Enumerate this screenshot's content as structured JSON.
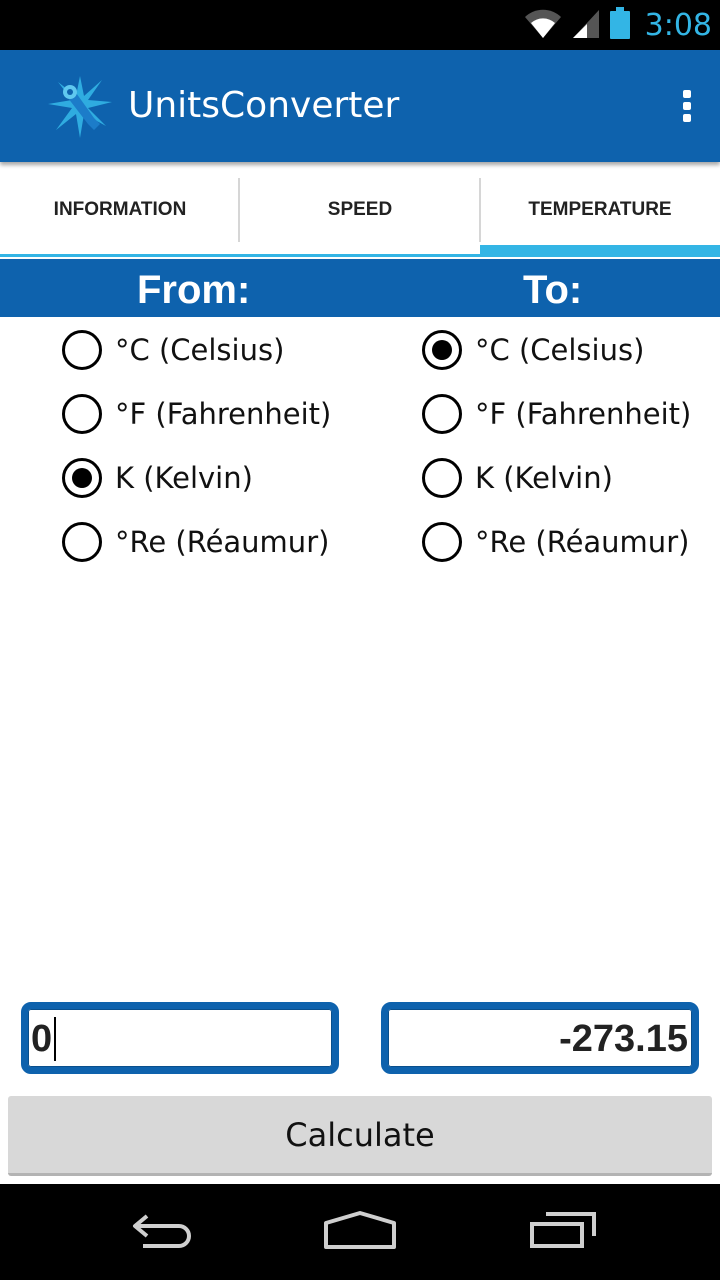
{
  "status_bar": {
    "time": "3:08",
    "icons": [
      "wifi-icon",
      "signal-icon",
      "battery-icon"
    ],
    "accent_color": "#33b5e5"
  },
  "action_bar": {
    "title": "UnitsConverter",
    "icon": "app-logo-icon",
    "overflow_icon": "overflow-menu-icon",
    "color": "#0e62ad"
  },
  "tabs": [
    {
      "label": "INFORMATION",
      "active": false
    },
    {
      "label": "SPEED",
      "active": false
    },
    {
      "label": "TEMPERATURE",
      "active": true
    }
  ],
  "converter": {
    "from_label": "From:",
    "to_label": "To:",
    "from_options": [
      {
        "label": "°C (Celsius)",
        "checked": false
      },
      {
        "label": "°F (Fahrenheit)",
        "checked": false
      },
      {
        "label": "K (Kelvin)",
        "checked": true
      },
      {
        "label": "°Re (Réaumur)",
        "checked": false
      }
    ],
    "to_options": [
      {
        "label": "°C (Celsius)",
        "checked": true
      },
      {
        "label": "°F (Fahrenheit)",
        "checked": false
      },
      {
        "label": "K (Kelvin)",
        "checked": false
      },
      {
        "label": "°Re (Réaumur)",
        "checked": false
      }
    ],
    "input_value": "0",
    "result_value": "-273.15",
    "calculate_label": "Calculate"
  },
  "nav_bar": {
    "buttons": [
      "back-icon",
      "home-icon",
      "recent-apps-icon"
    ]
  }
}
